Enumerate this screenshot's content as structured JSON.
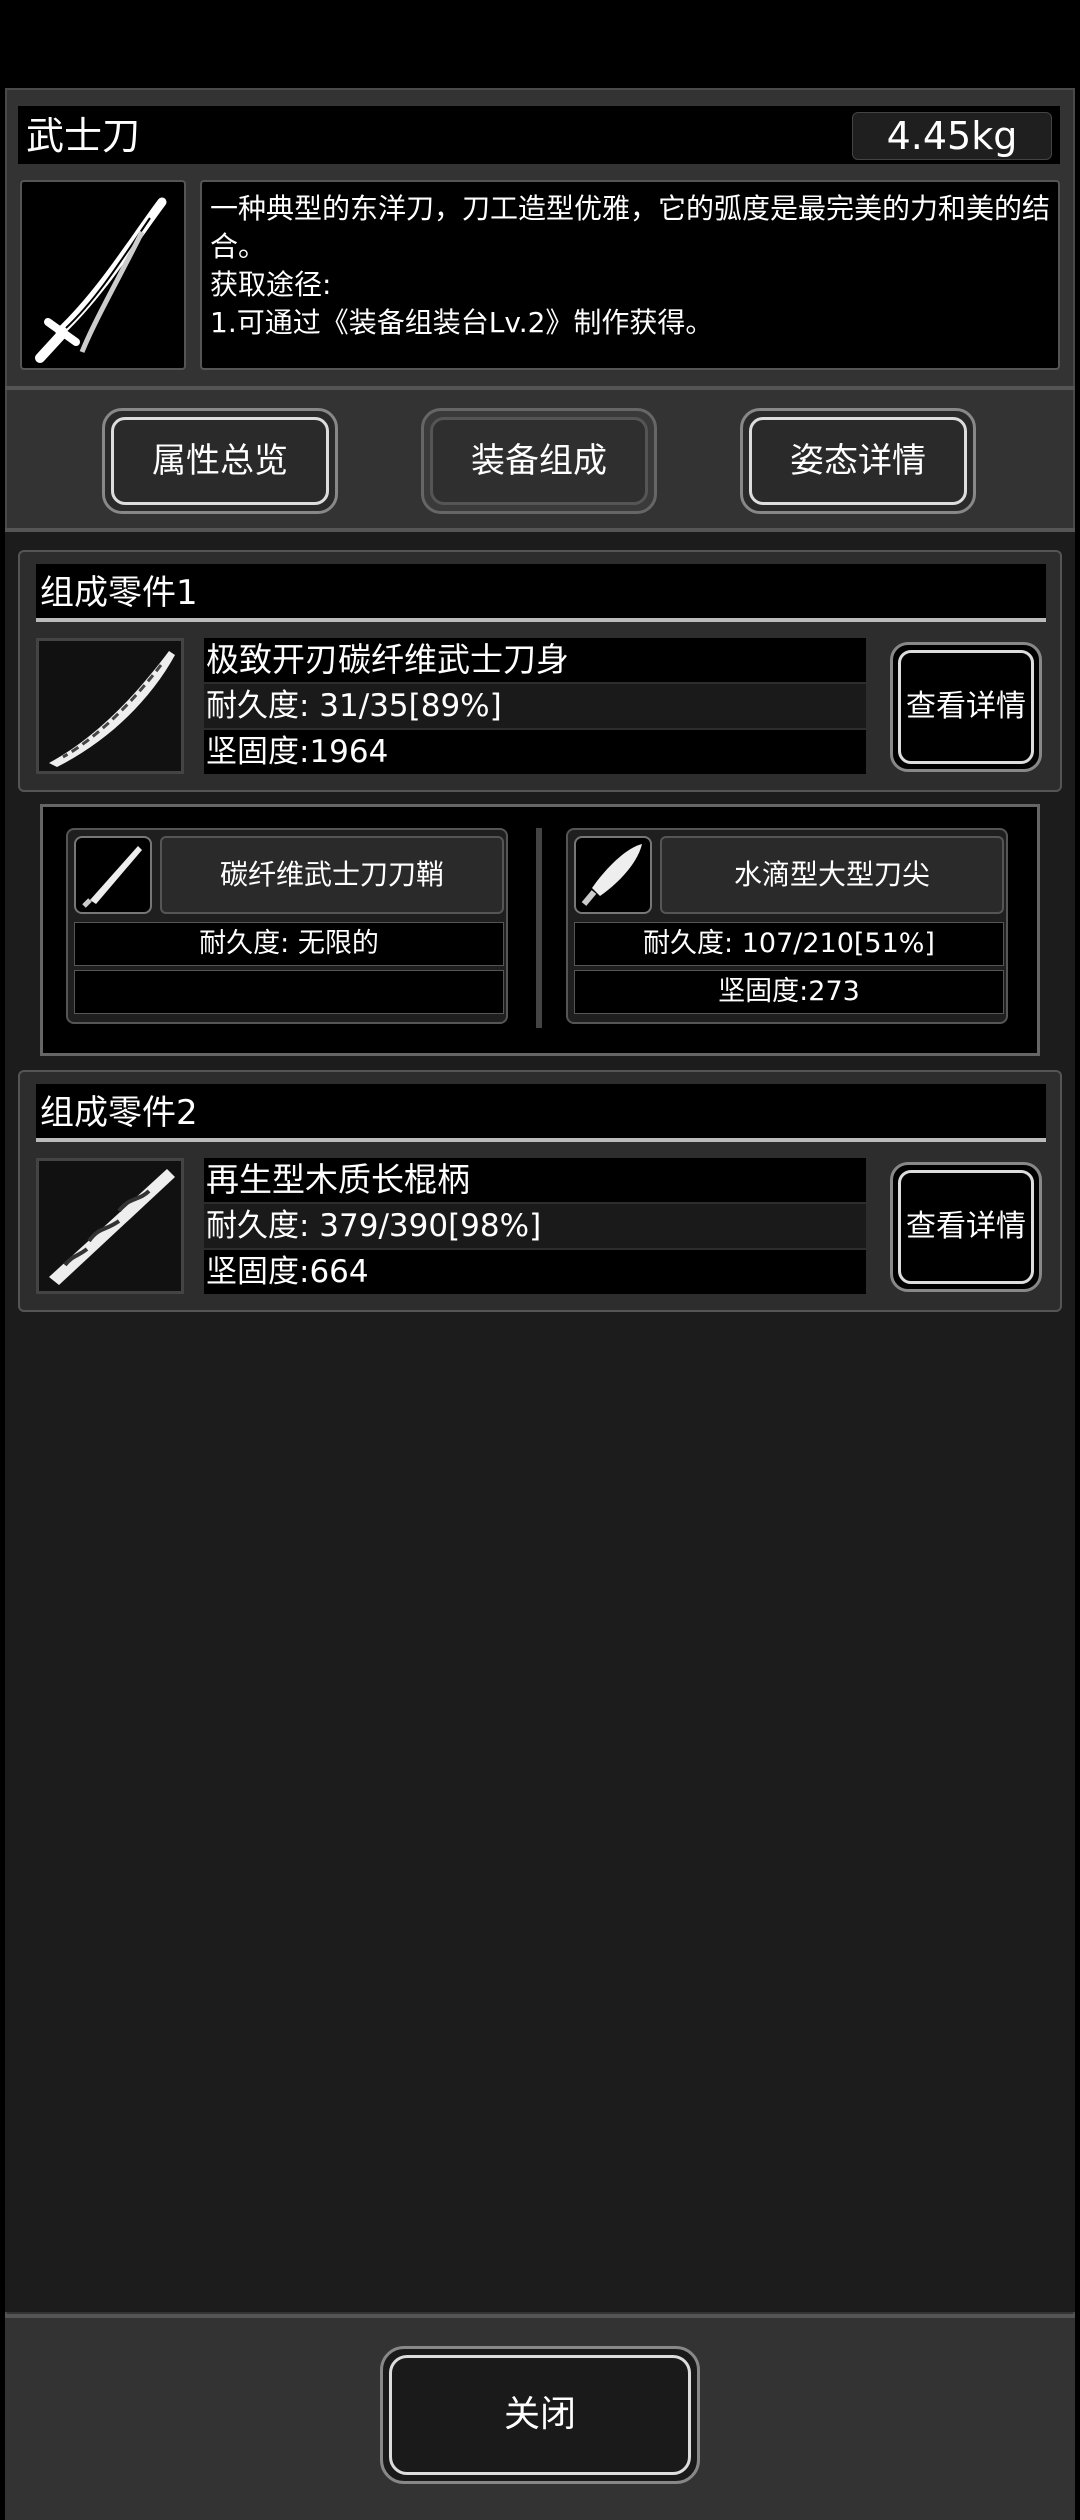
{
  "item": {
    "name": "武士刀",
    "weight": "4.45kg",
    "description": "一种典型的东洋刀，刀工造型优雅，它的弧度是最完美的力和美的结合。\n获取途径:\n1.可通过《装备组装台Lv.2》制作获得。",
    "icon": "katana-icon"
  },
  "tabs": [
    {
      "label": "属性总览"
    },
    {
      "label": "装备组成"
    },
    {
      "label": "姿态详情"
    }
  ],
  "active_tab": "装备组成",
  "groups": [
    {
      "title": "组成零件1",
      "part": {
        "name": "极致开刃碳纤维武士刀身",
        "durability": "耐久度: 31/35[89%]",
        "hardness": "坚固度:1964",
        "icon": "blade-icon"
      },
      "detail_label": "查看详情",
      "subparts": [
        {
          "name": "碳纤维武士刀刀鞘",
          "durability": "耐久度: 无限的",
          "hardness": "",
          "icon": "scabbard-icon"
        },
        {
          "name": "水滴型大型刀尖",
          "durability": "耐久度: 107/210[51%]",
          "hardness": "坚固度:273",
          "icon": "blade-tip-icon"
        }
      ]
    },
    {
      "title": "组成零件2",
      "part": {
        "name": "再生型木质长棍柄",
        "durability": "耐久度: 379/390[98%]",
        "hardness": "坚固度:664",
        "icon": "wooden-handle-icon"
      },
      "detail_label": "查看详情"
    }
  ],
  "close_label": "关闭",
  "colors": {
    "accent": "#dddddd",
    "panel": "#333333",
    "content_bg": "#1c1c1c"
  }
}
